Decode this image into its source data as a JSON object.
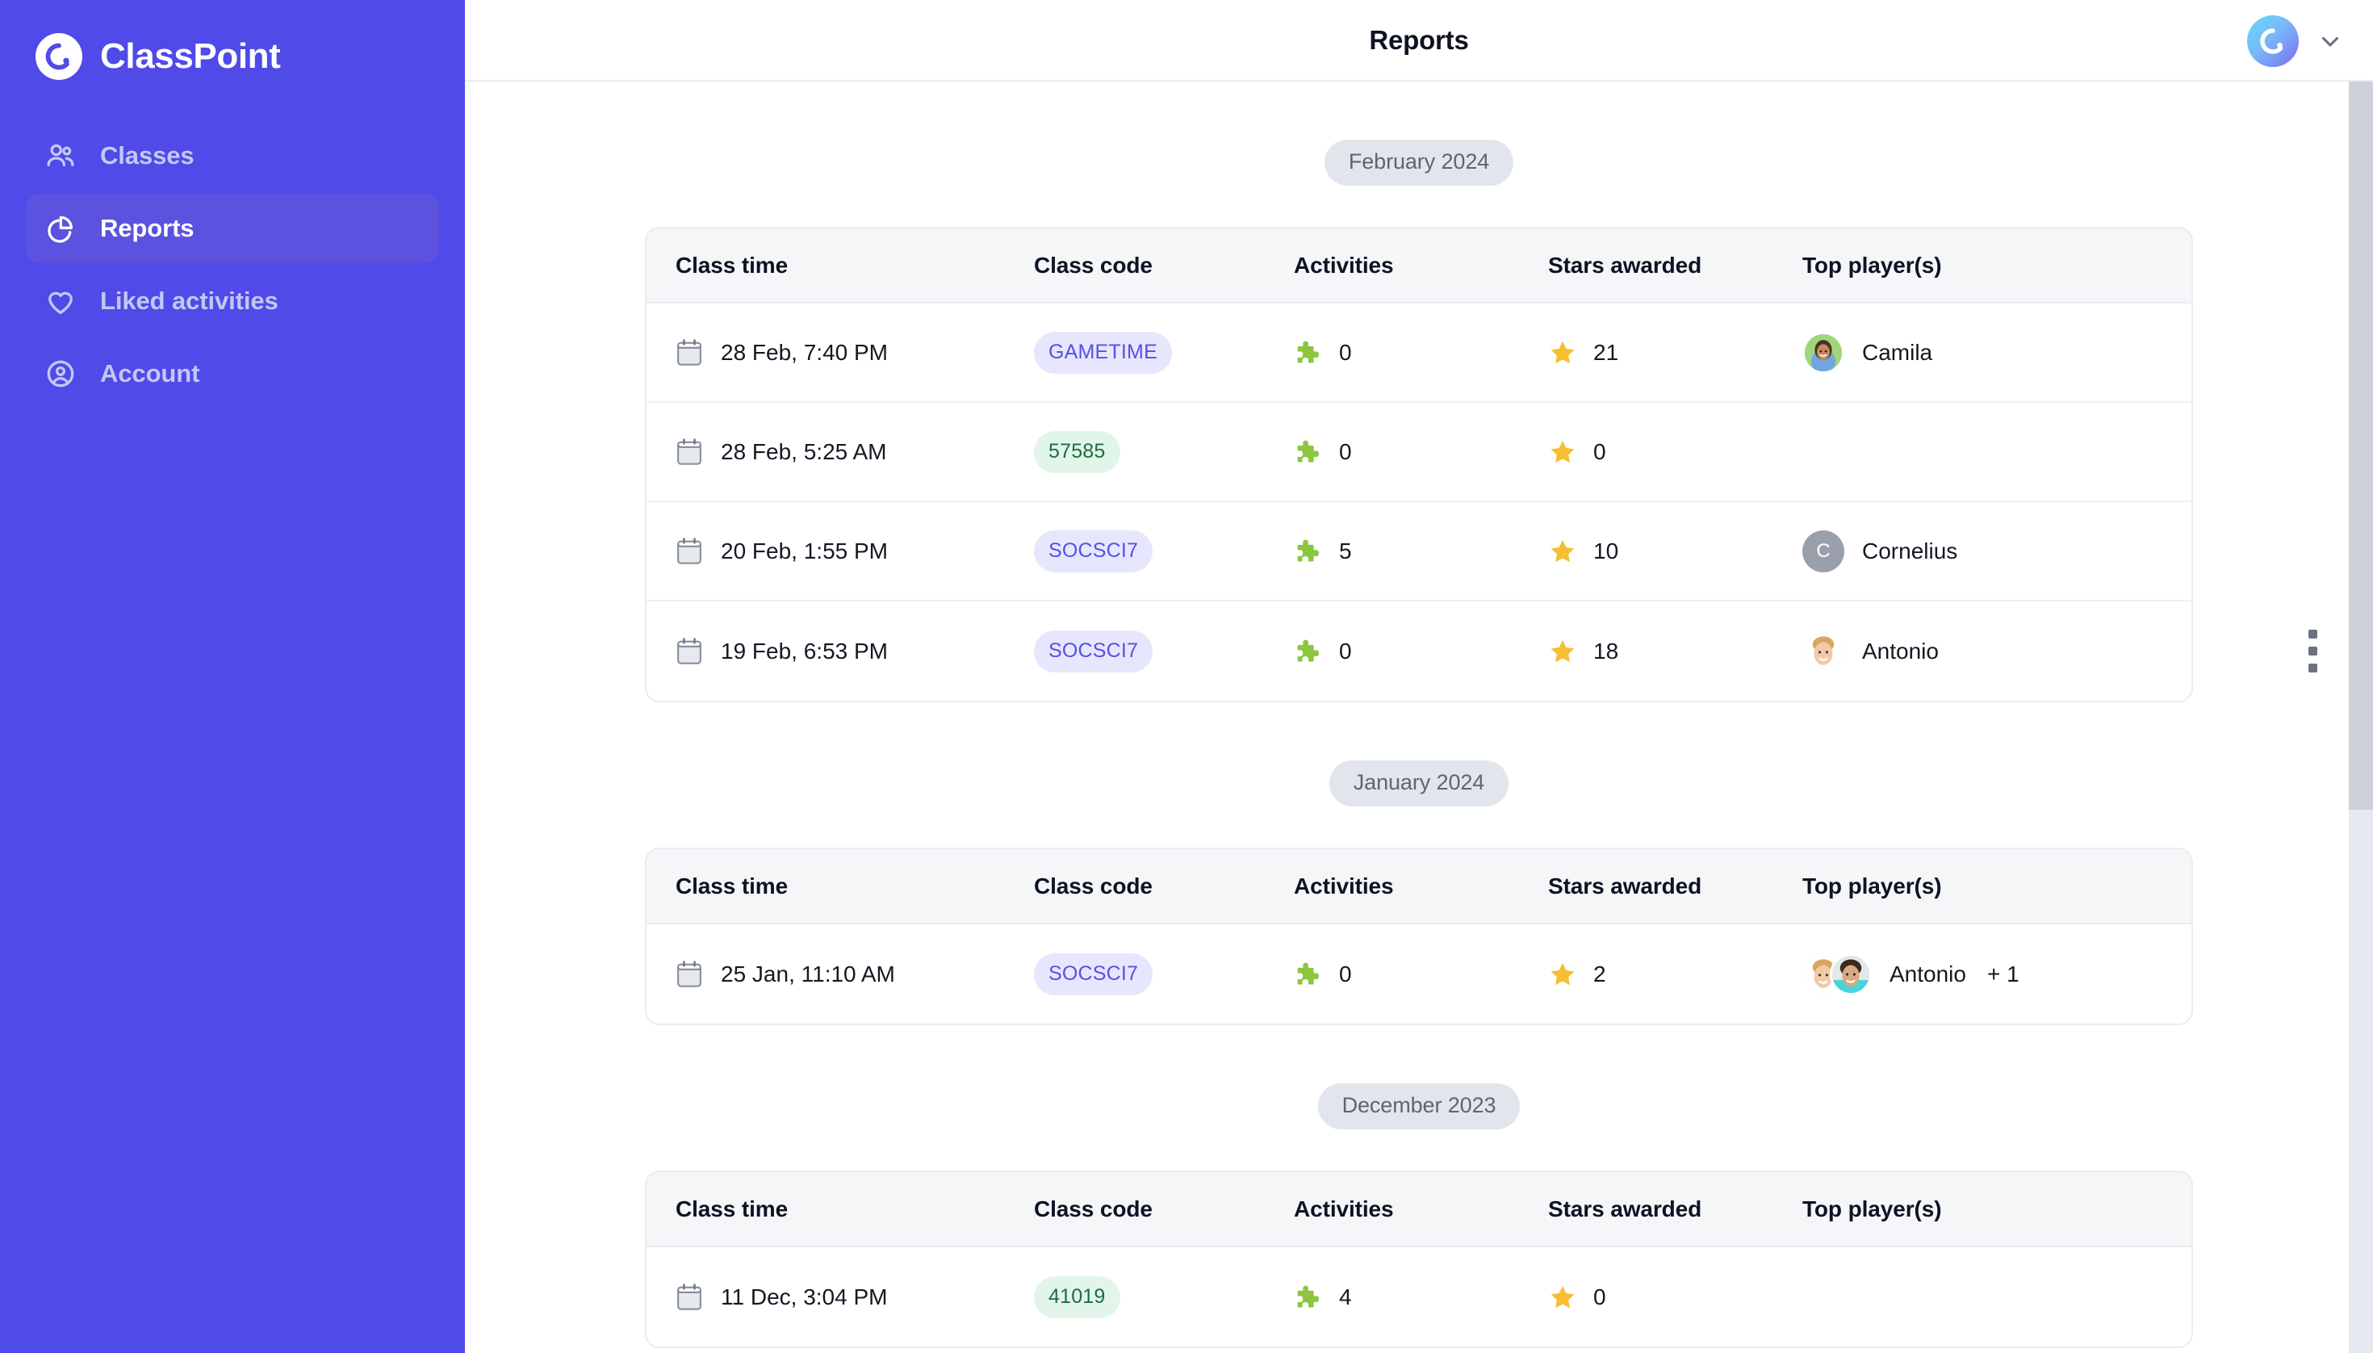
{
  "brand": {
    "name": "ClassPoint",
    "logo_icon": "classpoint-logo-icon"
  },
  "sidebar": {
    "items": [
      {
        "label": "Classes",
        "icon": "users-icon",
        "active": false
      },
      {
        "label": "Reports",
        "icon": "pie-chart-icon",
        "active": true
      },
      {
        "label": "Liked activities",
        "icon": "heart-icon",
        "active": false
      },
      {
        "label": "Account",
        "icon": "user-circle-icon",
        "active": false
      }
    ]
  },
  "topbar": {
    "title": "Reports",
    "avatar_icon": "classpoint-avatar-icon",
    "chevron_icon": "chevron-down-icon"
  },
  "colors": {
    "sidebar_bg": "#4f4ae8",
    "sidebar_active_bg": "#5b52e0",
    "badge_indigo_bg": "#e6e7fd",
    "badge_indigo_text": "#5650e8",
    "badge_green_bg": "#e1f5e9",
    "badge_green_text": "#1f6b43",
    "star": "#f5bf31",
    "puzzle": "#8cc63f",
    "month_pill_bg": "#e1e5ec"
  },
  "columns": [
    "Class time",
    "Class code",
    "Activities",
    "Stars awarded",
    "Top player(s)"
  ],
  "sections": [
    {
      "month": "February 2024",
      "rows": [
        {
          "class_time": "28 Feb, 7:40 PM",
          "class_code": "GAMETIME",
          "code_style": "indigo",
          "activities": "0",
          "stars": "21",
          "players": [
            "Camila"
          ],
          "avatars": [
            "photo-girl"
          ],
          "extra": ""
        },
        {
          "class_time": "28 Feb, 5:25 AM",
          "class_code": "57585",
          "code_style": "green",
          "activities": "0",
          "stars": "0",
          "players": [],
          "avatars": [],
          "extra": ""
        },
        {
          "class_time": "20 Feb, 1:55 PM",
          "class_code": "SOCSCI7",
          "code_style": "indigo",
          "activities": "5",
          "stars": "10",
          "players": [
            "Cornelius"
          ],
          "avatars": [
            "initial-C"
          ],
          "extra": ""
        },
        {
          "class_time": "19 Feb, 6:53 PM",
          "class_code": "SOCSCI7",
          "code_style": "indigo",
          "activities": "0",
          "stars": "18",
          "players": [
            "Antonio"
          ],
          "avatars": [
            "photo-boy-blond"
          ],
          "extra": ""
        }
      ]
    },
    {
      "month": "January 2024",
      "rows": [
        {
          "class_time": "25 Jan, 11:10 AM",
          "class_code": "SOCSCI7",
          "code_style": "indigo",
          "activities": "0",
          "stars": "2",
          "players": [
            "Antonio"
          ],
          "avatars": [
            "photo-boy-blond",
            "photo-boy-dark"
          ],
          "extra": "+ 1"
        }
      ]
    },
    {
      "month": "December 2023",
      "rows": [
        {
          "class_time": "11 Dec, 3:04 PM",
          "class_code": "41019",
          "code_style": "green",
          "activities": "4",
          "stars": "0",
          "players": [],
          "avatars": [],
          "extra": ""
        }
      ]
    }
  ],
  "row_menu_icon": "kebab-menu-icon",
  "scrollbar": {
    "name": "vertical-scrollbar"
  }
}
